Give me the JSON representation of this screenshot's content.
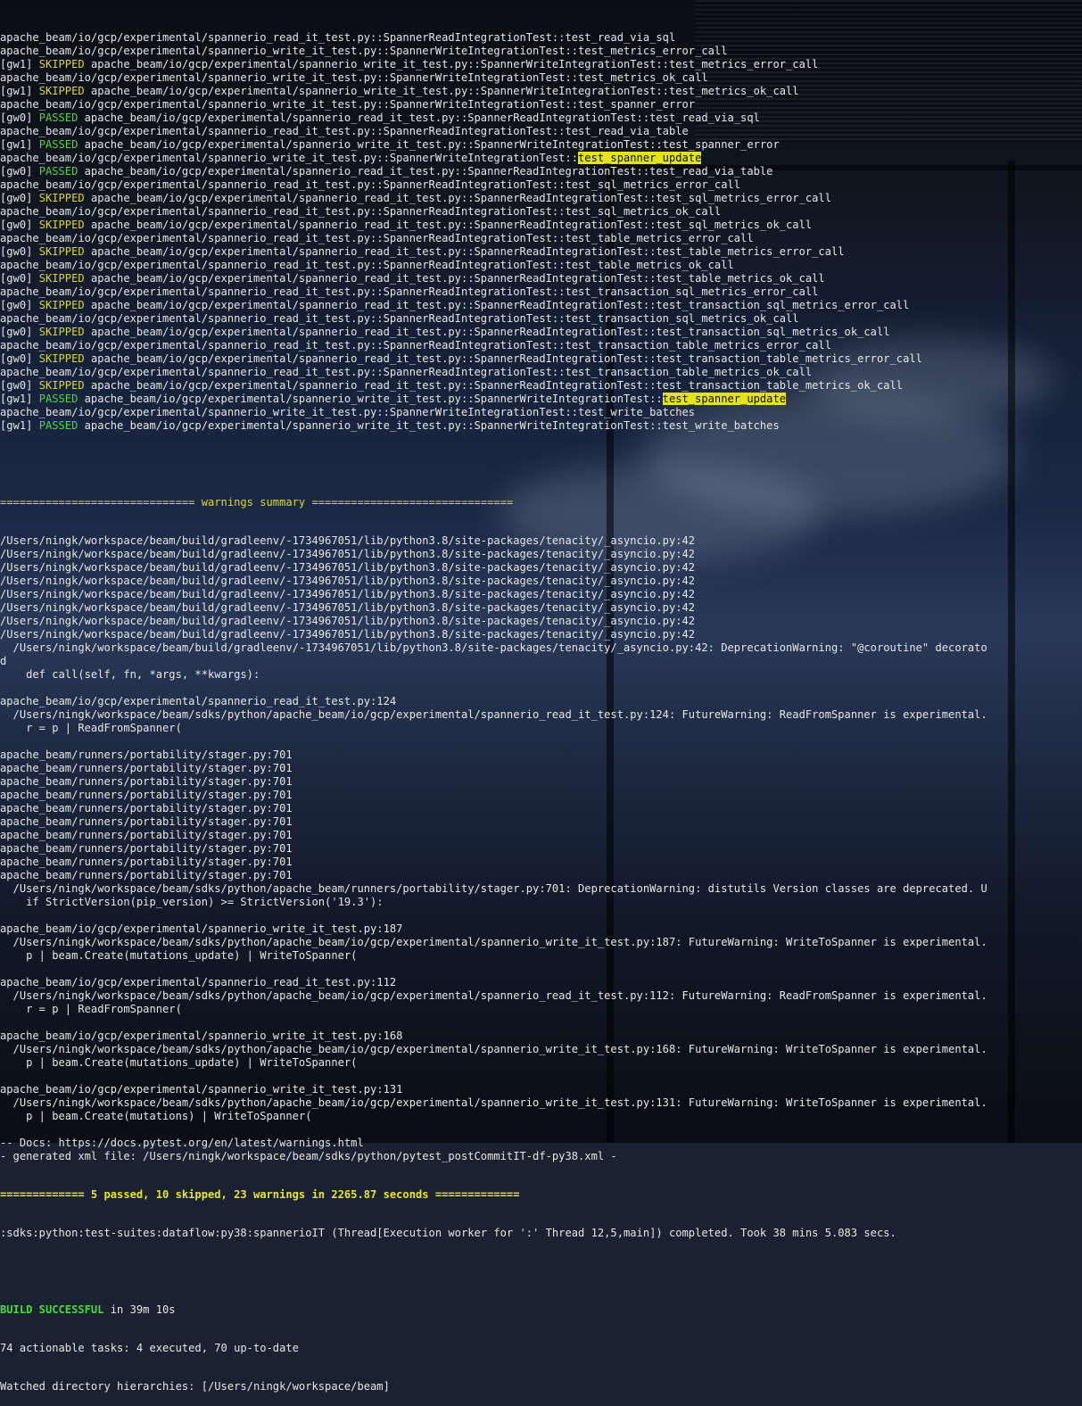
{
  "terminal": {
    "status_labels": {
      "skipped": "SKIPPED",
      "passed": "PASSED"
    },
    "worker_tags": {
      "gw0": "[gw0] ",
      "gw1": "[gw1] "
    },
    "test_lines": [
      {
        "worker": "",
        "status": "",
        "path": "apache_beam/io/gcp/experimental/spannerio_read_it_test.py::SpannerReadIntegrationTest::",
        "name": "test_read_via_sql",
        "hl": false
      },
      {
        "worker": "",
        "status": "",
        "path": "apache_beam/io/gcp/experimental/spannerio_write_it_test.py::SpannerWriteIntegrationTest::",
        "name": "test_metrics_error_call",
        "hl": false
      },
      {
        "worker": "gw1",
        "status": "skipped",
        "path": "apache_beam/io/gcp/experimental/spannerio_write_it_test.py::SpannerWriteIntegrationTest::",
        "name": "test_metrics_error_call",
        "hl": false
      },
      {
        "worker": "",
        "status": "",
        "path": "apache_beam/io/gcp/experimental/spannerio_write_it_test.py::SpannerWriteIntegrationTest::",
        "name": "test_metrics_ok_call",
        "hl": false
      },
      {
        "worker": "gw1",
        "status": "skipped",
        "path": "apache_beam/io/gcp/experimental/spannerio_write_it_test.py::SpannerWriteIntegrationTest::",
        "name": "test_metrics_ok_call",
        "hl": false
      },
      {
        "worker": "",
        "status": "",
        "path": "apache_beam/io/gcp/experimental/spannerio_write_it_test.py::SpannerWriteIntegrationTest::",
        "name": "test_spanner_error",
        "hl": false
      },
      {
        "worker": "gw0",
        "status": "passed",
        "path": "apache_beam/io/gcp/experimental/spannerio_read_it_test.py::SpannerReadIntegrationTest::",
        "name": "test_read_via_sql",
        "hl": false
      },
      {
        "worker": "",
        "status": "",
        "path": "apache_beam/io/gcp/experimental/spannerio_read_it_test.py::SpannerReadIntegrationTest::",
        "name": "test_read_via_table",
        "hl": false
      },
      {
        "worker": "gw1",
        "status": "passed",
        "path": "apache_beam/io/gcp/experimental/spannerio_write_it_test.py::SpannerWriteIntegrationTest::",
        "name": "test_spanner_error",
        "hl": false
      },
      {
        "worker": "",
        "status": "",
        "path": "apache_beam/io/gcp/experimental/spannerio_write_it_test.py::SpannerWriteIntegrationTest::",
        "name": "test_spanner_update",
        "hl": true
      },
      {
        "worker": "gw0",
        "status": "passed",
        "path": "apache_beam/io/gcp/experimental/spannerio_read_it_test.py::SpannerReadIntegrationTest::",
        "name": "test_read_via_table",
        "hl": false
      },
      {
        "worker": "",
        "status": "",
        "path": "apache_beam/io/gcp/experimental/spannerio_read_it_test.py::SpannerReadIntegrationTest::",
        "name": "test_sql_metrics_error_call",
        "hl": false
      },
      {
        "worker": "gw0",
        "status": "skipped",
        "path": "apache_beam/io/gcp/experimental/spannerio_read_it_test.py::SpannerReadIntegrationTest::",
        "name": "test_sql_metrics_error_call",
        "hl": false
      },
      {
        "worker": "",
        "status": "",
        "path": "apache_beam/io/gcp/experimental/spannerio_read_it_test.py::SpannerReadIntegrationTest::",
        "name": "test_sql_metrics_ok_call",
        "hl": false
      },
      {
        "worker": "gw0",
        "status": "skipped",
        "path": "apache_beam/io/gcp/experimental/spannerio_read_it_test.py::SpannerReadIntegrationTest::",
        "name": "test_sql_metrics_ok_call",
        "hl": false
      },
      {
        "worker": "",
        "status": "",
        "path": "apache_beam/io/gcp/experimental/spannerio_read_it_test.py::SpannerReadIntegrationTest::",
        "name": "test_table_metrics_error_call",
        "hl": false
      },
      {
        "worker": "gw0",
        "status": "skipped",
        "path": "apache_beam/io/gcp/experimental/spannerio_read_it_test.py::SpannerReadIntegrationTest::",
        "name": "test_table_metrics_error_call",
        "hl": false
      },
      {
        "worker": "",
        "status": "",
        "path": "apache_beam/io/gcp/experimental/spannerio_read_it_test.py::SpannerReadIntegrationTest::",
        "name": "test_table_metrics_ok_call",
        "hl": false
      },
      {
        "worker": "gw0",
        "status": "skipped",
        "path": "apache_beam/io/gcp/experimental/spannerio_read_it_test.py::SpannerReadIntegrationTest::",
        "name": "test_table_metrics_ok_call",
        "hl": false
      },
      {
        "worker": "",
        "status": "",
        "path": "apache_beam/io/gcp/experimental/spannerio_read_it_test.py::SpannerReadIntegrationTest::",
        "name": "test_transaction_sql_metrics_error_call",
        "hl": false
      },
      {
        "worker": "gw0",
        "status": "skipped",
        "path": "apache_beam/io/gcp/experimental/spannerio_read_it_test.py::SpannerReadIntegrationTest::",
        "name": "test_transaction_sql_metrics_error_call",
        "hl": false
      },
      {
        "worker": "",
        "status": "",
        "path": "apache_beam/io/gcp/experimental/spannerio_read_it_test.py::SpannerReadIntegrationTest::",
        "name": "test_transaction_sql_metrics_ok_call",
        "hl": false
      },
      {
        "worker": "gw0",
        "status": "skipped",
        "path": "apache_beam/io/gcp/experimental/spannerio_read_it_test.py::SpannerReadIntegrationTest::",
        "name": "test_transaction_sql_metrics_ok_call",
        "hl": false
      },
      {
        "worker": "",
        "status": "",
        "path": "apache_beam/io/gcp/experimental/spannerio_read_it_test.py::SpannerReadIntegrationTest::",
        "name": "test_transaction_table_metrics_error_call",
        "hl": false
      },
      {
        "worker": "gw0",
        "status": "skipped",
        "path": "apache_beam/io/gcp/experimental/spannerio_read_it_test.py::SpannerReadIntegrationTest::",
        "name": "test_transaction_table_metrics_error_call",
        "hl": false
      },
      {
        "worker": "",
        "status": "",
        "path": "apache_beam/io/gcp/experimental/spannerio_read_it_test.py::SpannerReadIntegrationTest::",
        "name": "test_transaction_table_metrics_ok_call",
        "hl": false
      },
      {
        "worker": "gw0",
        "status": "skipped",
        "path": "apache_beam/io/gcp/experimental/spannerio_read_it_test.py::SpannerReadIntegrationTest::",
        "name": "test_transaction_table_metrics_ok_call",
        "hl": false
      },
      {
        "worker": "gw1",
        "status": "passed",
        "path": "apache_beam/io/gcp/experimental/spannerio_write_it_test.py::SpannerWriteIntegrationTest::",
        "name": "test_spanner_update",
        "hl": true
      },
      {
        "worker": "",
        "status": "",
        "path": "apache_beam/io/gcp/experimental/spannerio_write_it_test.py::SpannerWriteIntegrationTest::",
        "name": "test_write_batches",
        "hl": false
      },
      {
        "worker": "gw1",
        "status": "passed",
        "path": "apache_beam/io/gcp/experimental/spannerio_write_it_test.py::SpannerWriteIntegrationTest::",
        "name": "test_write_batches",
        "hl": false
      }
    ],
    "warnings_header": "============================== warnings summary ===============================",
    "warning_lines": [
      "/Users/ningk/workspace/beam/build/gradleenv/-1734967051/lib/python3.8/site-packages/tenacity/_asyncio.py:42",
      "/Users/ningk/workspace/beam/build/gradleenv/-1734967051/lib/python3.8/site-packages/tenacity/_asyncio.py:42",
      "/Users/ningk/workspace/beam/build/gradleenv/-1734967051/lib/python3.8/site-packages/tenacity/_asyncio.py:42",
      "/Users/ningk/workspace/beam/build/gradleenv/-1734967051/lib/python3.8/site-packages/tenacity/_asyncio.py:42",
      "/Users/ningk/workspace/beam/build/gradleenv/-1734967051/lib/python3.8/site-packages/tenacity/_asyncio.py:42",
      "/Users/ningk/workspace/beam/build/gradleenv/-1734967051/lib/python3.8/site-packages/tenacity/_asyncio.py:42",
      "/Users/ningk/workspace/beam/build/gradleenv/-1734967051/lib/python3.8/site-packages/tenacity/_asyncio.py:42",
      "/Users/ningk/workspace/beam/build/gradleenv/-1734967051/lib/python3.8/site-packages/tenacity/_asyncio.py:42",
      "  /Users/ningk/workspace/beam/build/gradleenv/-1734967051/lib/python3.8/site-packages/tenacity/_asyncio.py:42: DeprecationWarning: \"@coroutine\" decorato",
      "d",
      "    def call(self, fn, *args, **kwargs):",
      "",
      "apache_beam/io/gcp/experimental/spannerio_read_it_test.py:124",
      "  /Users/ningk/workspace/beam/sdks/python/apache_beam/io/gcp/experimental/spannerio_read_it_test.py:124: FutureWarning: ReadFromSpanner is experimental.",
      "    r = p | ReadFromSpanner(",
      "",
      "apache_beam/runners/portability/stager.py:701",
      "apache_beam/runners/portability/stager.py:701",
      "apache_beam/runners/portability/stager.py:701",
      "apache_beam/runners/portability/stager.py:701",
      "apache_beam/runners/portability/stager.py:701",
      "apache_beam/runners/portability/stager.py:701",
      "apache_beam/runners/portability/stager.py:701",
      "apache_beam/runners/portability/stager.py:701",
      "apache_beam/runners/portability/stager.py:701",
      "apache_beam/runners/portability/stager.py:701",
      "  /Users/ningk/workspace/beam/sdks/python/apache_beam/runners/portability/stager.py:701: DeprecationWarning: distutils Version classes are deprecated. U",
      "    if StrictVersion(pip_version) >= StrictVersion('19.3'):",
      "",
      "apache_beam/io/gcp/experimental/spannerio_write_it_test.py:187",
      "  /Users/ningk/workspace/beam/sdks/python/apache_beam/io/gcp/experimental/spannerio_write_it_test.py:187: FutureWarning: WriteToSpanner is experimental.",
      "    p | beam.Create(mutations_update) | WriteToSpanner(",
      "",
      "apache_beam/io/gcp/experimental/spannerio_read_it_test.py:112",
      "  /Users/ningk/workspace/beam/sdks/python/apache_beam/io/gcp/experimental/spannerio_read_it_test.py:112: FutureWarning: ReadFromSpanner is experimental.",
      "    r = p | ReadFromSpanner(",
      "",
      "apache_beam/io/gcp/experimental/spannerio_write_it_test.py:168",
      "  /Users/ningk/workspace/beam/sdks/python/apache_beam/io/gcp/experimental/spannerio_write_it_test.py:168: FutureWarning: WriteToSpanner is experimental.",
      "    p | beam.Create(mutations_update) | WriteToSpanner(",
      "",
      "apache_beam/io/gcp/experimental/spannerio_write_it_test.py:131",
      "  /Users/ningk/workspace/beam/sdks/python/apache_beam/io/gcp/experimental/spannerio_write_it_test.py:131: FutureWarning: WriteToSpanner is experimental.",
      "    p | beam.Create(mutations) | WriteToSpanner(",
      "",
      "-- Docs: https://docs.pytest.org/en/latest/warnings.html",
      "- generated xml file: /Users/ningk/workspace/beam/sdks/python/pytest_postCommitIT-df-py38.xml -"
    ],
    "summary_line": "============= 5 passed, 10 skipped, 23 warnings in 2265.87 seconds =============",
    "task_line": ":sdks:python:test-suites:dataflow:py38:spannerioIT (Thread[Execution worker for ':' Thread 12,5,main]) completed. Took 38 mins 5.083 secs.",
    "build_status": "BUILD SUCCESSFUL",
    "build_time": " in 39m 10s",
    "tasks_line": "74 actionable tasks: 4 executed, 70 up-to-date",
    "watched_line": "Watched directory hierarchies: [/Users/ningk/workspace/beam]"
  },
  "colors": {
    "passed": "#4cd940",
    "skipped": "#d8d838",
    "highlight": "#e2e21e",
    "text": "#e6e6e6"
  }
}
